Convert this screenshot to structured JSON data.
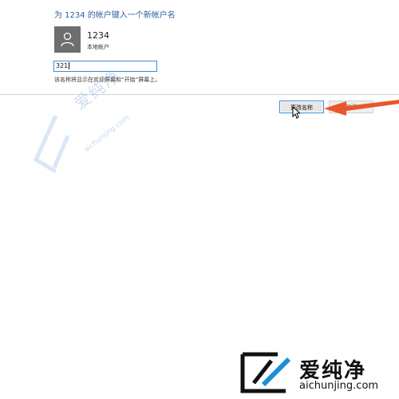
{
  "dialog": {
    "heading": "为 1234 的帐户键入一个新帐户名",
    "account": {
      "name": "1234",
      "type": "本地帐户"
    },
    "name_input_value": "321",
    "hint": "该名称将显示在欢迎屏幕和“开始”屏幕上。",
    "buttons": {
      "change_name": "更改名称",
      "cancel": "取消"
    }
  },
  "watermark": {
    "brand": "爱纯净",
    "url": "aichunjing.com"
  },
  "colors": {
    "heading": "#2e5e9e",
    "avatar_bg": "#6e6e6e",
    "focus_border": "#3c8ed6",
    "arrow": "#e8562a"
  }
}
